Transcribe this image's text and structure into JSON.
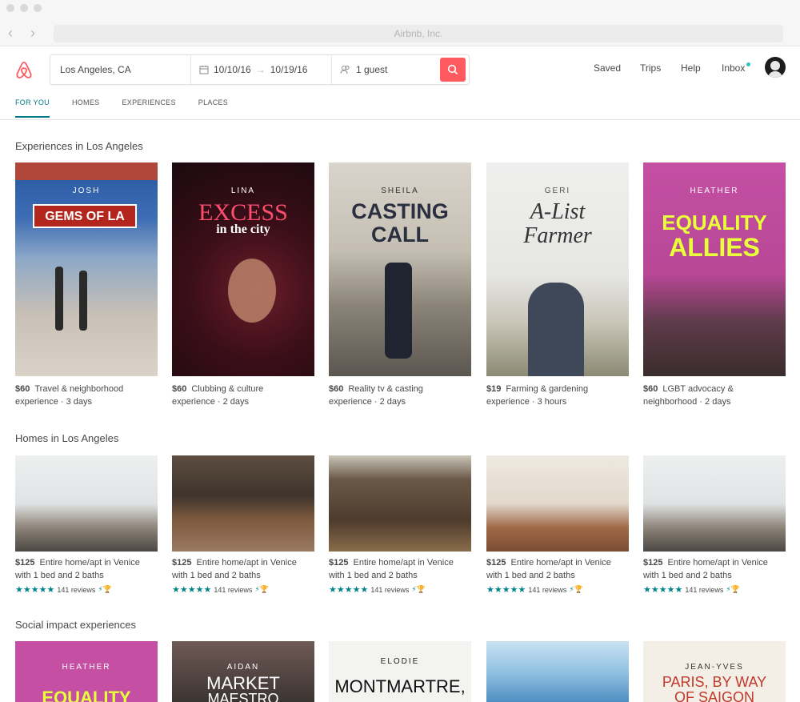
{
  "window": {
    "url": "Airbnb, Inc."
  },
  "search": {
    "location": "Los Angeles, CA",
    "check_in": "10/10/16",
    "check_out": "10/19/16",
    "guests": "1 guest"
  },
  "nav": {
    "saved": "Saved",
    "trips": "Trips",
    "help": "Help",
    "inbox": "Inbox"
  },
  "tabs": [
    "FOR YOU",
    "HOMES",
    "EXPERIENCES",
    "PLACES"
  ],
  "active_tab": "FOR YOU",
  "sections": {
    "experiences_title": "Experiences in Los Angeles",
    "homes_title": "Homes in Los Angeles",
    "social_title": "Social impact experiences"
  },
  "experiences": [
    {
      "host": "JOSH",
      "headline": "GEMS OF LA",
      "price": "$60",
      "title": "Travel & neighborhood",
      "meta": "experience · 3 days"
    },
    {
      "host": "LINA",
      "headline": "EXCESS",
      "headline2": "in the city",
      "price": "$60",
      "title": "Clubbing & culture",
      "meta": "experience · 2 days"
    },
    {
      "host": "SHEILA",
      "headline": "CASTING",
      "headline2": "CALL",
      "price": "$60",
      "title": "Reality tv & casting",
      "meta": "experience · 2 days"
    },
    {
      "host": "GERI",
      "headline": "A-List",
      "headline2": "Farmer",
      "price": "$19",
      "title": "Farming & gardening",
      "meta": "experience · 3 hours"
    },
    {
      "host": "HEATHER",
      "headline": "EQUALITY",
      "headline2": "ALLIES",
      "price": "$60",
      "title": "LGBT advocacy &",
      "meta": "neighborhood · 2 days"
    }
  ],
  "homes": [
    {
      "price": "$125",
      "title": "Entire home/apt in Venice",
      "meta": "with 1 bed and 2 baths",
      "reviews": "141 reviews",
      "rating": 5
    },
    {
      "price": "$125",
      "title": "Entire home/apt in Venice",
      "meta": "with 1 bed and 2 baths",
      "reviews": "141 reviews",
      "rating": 5
    },
    {
      "price": "$125",
      "title": "Entire home/apt in Venice",
      "meta": "with 1 bed and 2 baths",
      "reviews": "141 reviews",
      "rating": 5
    },
    {
      "price": "$125",
      "title": "Entire home/apt in Venice",
      "meta": "with 1 bed and 2 baths",
      "reviews": "141 reviews",
      "rating": 5
    },
    {
      "price": "$125",
      "title": "Entire home/apt in Venice",
      "meta": "with 1 bed and 2 baths",
      "reviews": "141 reviews",
      "rating": 5
    }
  ],
  "social": [
    {
      "host": "HEATHER",
      "headline": "EQUALITY"
    },
    {
      "host": "AIDAN",
      "headline": "MARKET",
      "headline2": "MAESTRO"
    },
    {
      "host": "ELODIE",
      "headline": "MONTMARTRE,"
    },
    {
      "host": "",
      "headline": ""
    },
    {
      "host": "JEAN-YVES",
      "headline": "PARIS, BY WAY",
      "headline2": "OF SAIGON"
    }
  ],
  "colors": {
    "brand": "#ff5a5f",
    "teal": "#008489",
    "text": "#484848"
  }
}
